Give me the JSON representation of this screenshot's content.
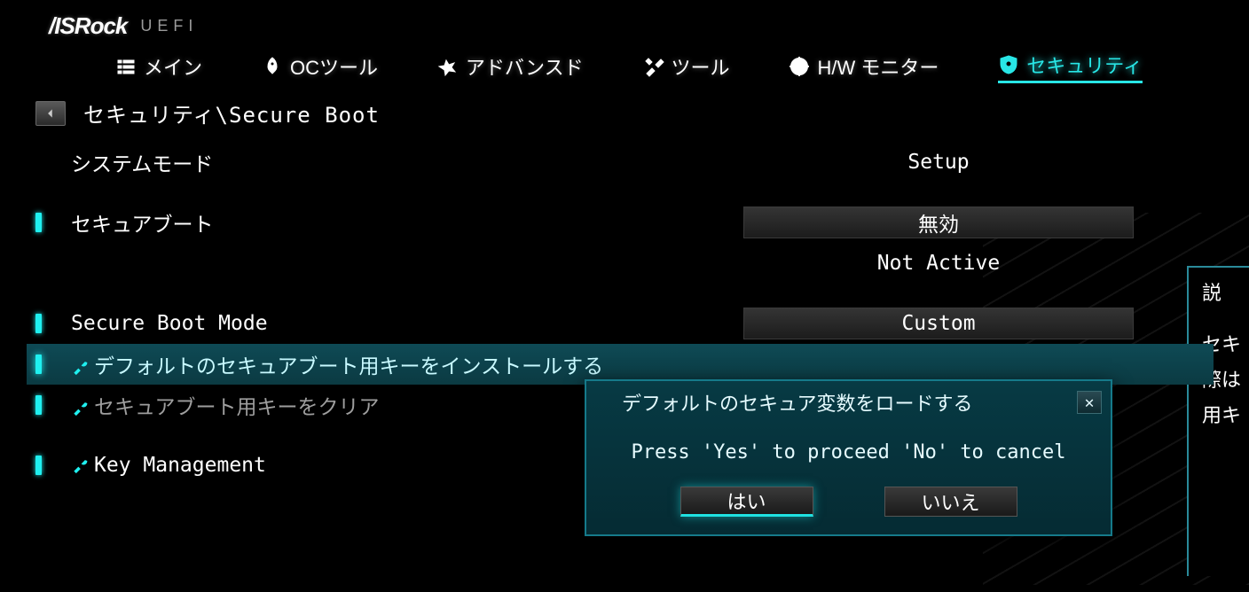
{
  "logo": {
    "brand": "/ISRock",
    "sub": "UEFI"
  },
  "nav": {
    "main": "メイン",
    "oc": "OCツール",
    "advanced": "アドバンスド",
    "tool": "ツール",
    "hw": "H/W モニター",
    "security": "セキュリティ"
  },
  "breadcrumb": "セキュリティ\\Secure Boot",
  "rows": {
    "system_mode": {
      "label": "システムモード",
      "value": "Setup"
    },
    "secure_boot": {
      "label": "セキュアブート",
      "value_select": "無効",
      "status": "Not Active"
    },
    "mode": {
      "label": "Secure Boot Mode",
      "value_select": "Custom"
    },
    "install_keys": {
      "label": "デフォルトのセキュアブート用キーをインストールする"
    },
    "clear_keys": {
      "label": "セキュアブート用キーをクリア"
    },
    "key_mgmt": {
      "label": "Key Management"
    }
  },
  "side": {
    "title": "説",
    "line1": "セキ",
    "line2": "際は",
    "line3": "用キ"
  },
  "modal": {
    "title": "デフォルトのセキュア変数をロードする",
    "body": "Press 'Yes' to proceed 'No' to cancel",
    "yes": "はい",
    "no": "いいえ"
  }
}
